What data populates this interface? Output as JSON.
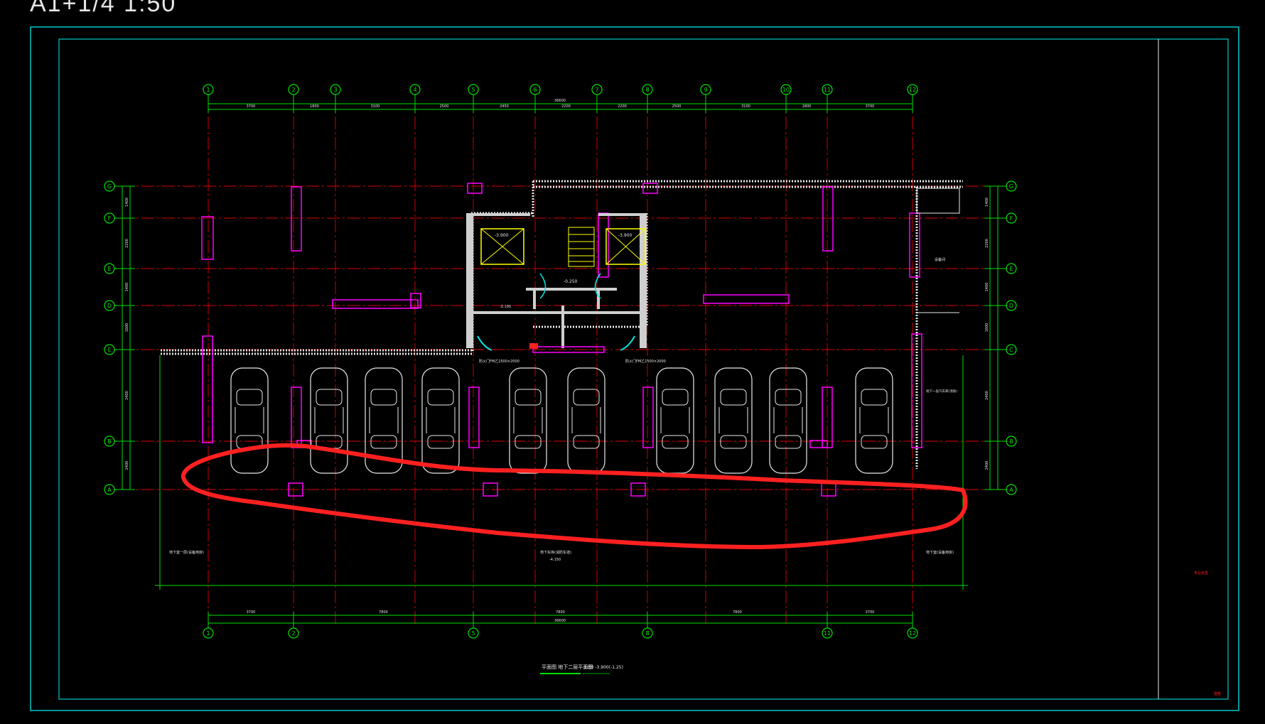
{
  "sheet": {
    "label": "A1+1/4  1:50"
  },
  "colors": {
    "background": "#000000",
    "frame": "#00c8c8",
    "axis": "#00e000",
    "centerline": "#e00000",
    "wall_hatch": "#ff00ff",
    "walls": "#e8e8e8",
    "elevator": "#ffff00",
    "door": "#00e8e8",
    "markup": "#ff2020"
  },
  "grid": {
    "columns": [
      "1",
      "2",
      "3",
      "4",
      "5",
      "6",
      "7",
      "8",
      "9",
      "10",
      "11",
      "12"
    ],
    "bottom_columns": [
      "1",
      "2",
      "5",
      "8",
      "11",
      "12"
    ],
    "rows": [
      "G",
      "F",
      "E",
      "D",
      "C",
      "B",
      "A"
    ]
  },
  "dimensions": {
    "top_total": "36600",
    "top": [
      "3700",
      "1800",
      "3100",
      "2500",
      "2450",
      "2200",
      "2200",
      "2500",
      "3100",
      "1800",
      "3700"
    ],
    "bottom_total": "36600",
    "bottom": [
      "3700",
      "7800",
      "7800",
      "7800",
      "3700"
    ],
    "left": [
      "1400",
      "2200",
      "1400",
      "1600",
      "2400",
      "2400"
    ],
    "left_total": "12000",
    "right": [
      "1400",
      "2200",
      "1400",
      "1600",
      "2400",
      "2400"
    ],
    "right_total": "12000"
  },
  "rooms": {
    "elevator_left": "-3.900",
    "elevator_right": "-3.900",
    "level_center": "-0.250",
    "level_left": "-2.100",
    "exit_note_left": "防火门FM乙1500×2000",
    "exit_note_right": "防火门FM乙1500×2000",
    "right_room": "设备间",
    "right_long": "地下一层汽车库(消防)"
  },
  "bottom_notes": {
    "left": "地下室一层(设备用房)",
    "center": "地下车库(消防车道)",
    "right": "地下室(设备用房)",
    "level": "-4.150"
  },
  "drawing_title": "平面图  地下二层平面图",
  "drawing_scale": "1:50  -3.900(-1.25)",
  "title_block_note": "专业会签",
  "sheet_number": "建施"
}
